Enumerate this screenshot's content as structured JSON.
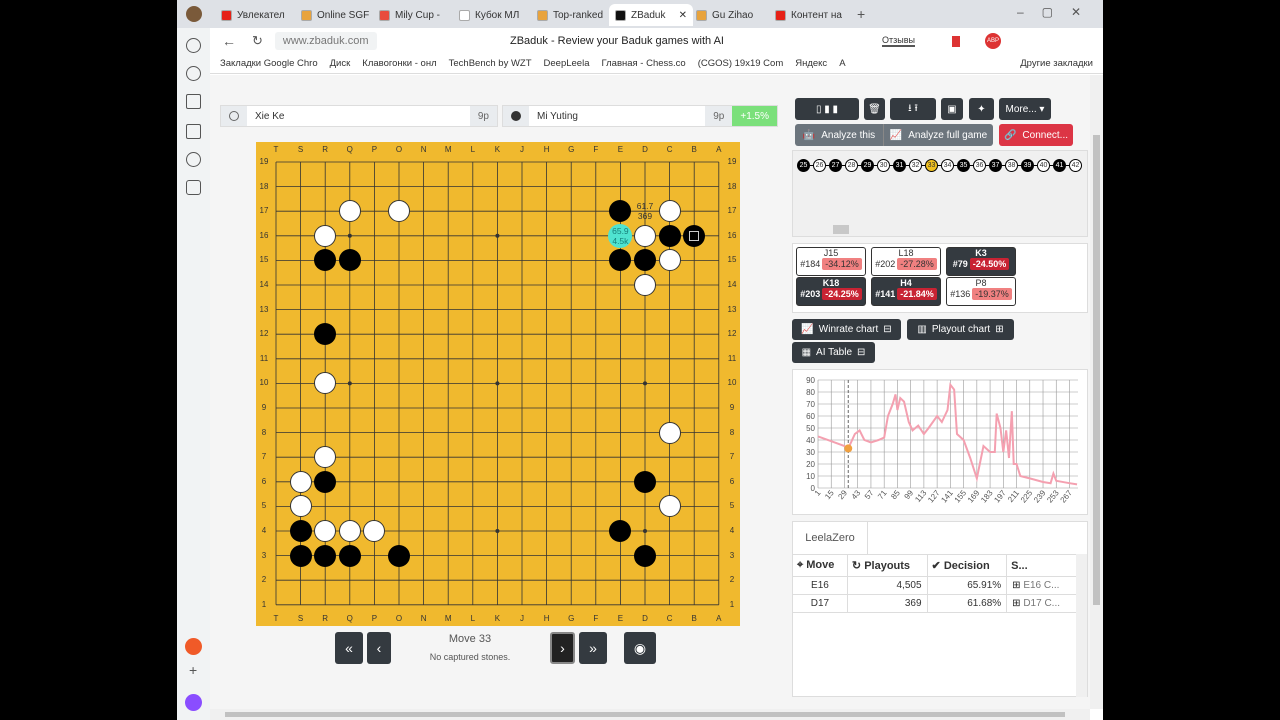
{
  "browser": {
    "tabs": [
      {
        "label": "Увлекател",
        "color": "#e62117"
      },
      {
        "label": "Online SGF",
        "color": "#e8a33d"
      },
      {
        "label": "Mily Cup -",
        "color": "#e84c3d"
      },
      {
        "label": "Кубок МЛ",
        "color": "#fff"
      },
      {
        "label": "Top-ranked",
        "color": "#e8a33d"
      },
      {
        "label": "ZBaduk",
        "color": "#111"
      },
      {
        "label": "Gu Zihao",
        "color": "#e8a33d"
      },
      {
        "label": "Контент на",
        "color": "#e62117"
      }
    ],
    "url": "www.zbaduk.com",
    "page_title": "ZBaduk - Review your Baduk games with AI",
    "reviews": "Отзывы",
    "bookmarks": [
      "Закладки Google Chro",
      "Диск",
      "Клавогонки - онл",
      "TechBench by WZT",
      "DeepLeela",
      "Главная - Chess.co",
      "(CGOS) 19x19 Com",
      "Яндекс",
      "A"
    ],
    "other_bookmarks": "Другие закладки"
  },
  "players": {
    "white": {
      "name": "Xie Ke",
      "rank": "9p"
    },
    "black": {
      "name": "Mi Yuting",
      "rank": "9p",
      "score": "+1.5%"
    }
  },
  "board": {
    "columns": [
      "T",
      "S",
      "R",
      "Q",
      "P",
      "O",
      "N",
      "M",
      "L",
      "K",
      "J",
      "H",
      "G",
      "F",
      "E",
      "D",
      "C",
      "B",
      "A"
    ],
    "rows": [
      "19",
      "18",
      "17",
      "16",
      "15",
      "14",
      "13",
      "12",
      "11",
      "10",
      "9",
      "8",
      "7",
      "6",
      "5",
      "4",
      "3",
      "2",
      "1"
    ],
    "black": [
      "E17",
      "C16",
      "B16",
      "E15",
      "D15",
      "R15",
      "Q15",
      "R12",
      "R6",
      "D6",
      "S4",
      "E4",
      "S3",
      "R3",
      "Q3",
      "O3",
      "D3"
    ],
    "white": [
      "Q17",
      "O17",
      "C17",
      "R16",
      "D16",
      "C15",
      "D14",
      "R10",
      "C8",
      "R7",
      "S6",
      "S5",
      "C5",
      "R4",
      "Q4",
      "P4"
    ],
    "last_move": "B16",
    "candidates": [
      {
        "point": "E16",
        "winrate": "65.9",
        "playouts": "4.5k",
        "best": true
      },
      {
        "point": "D17",
        "winrate": "61.7",
        "playouts": "369",
        "best": false
      }
    ]
  },
  "nav": {
    "move": "Move 33",
    "captured": "No captured stones.",
    "first": "«",
    "prev": "‹",
    "next": "›",
    "last": "»"
  },
  "toolbar": {
    "more": "More...",
    "analyze_this": "Analyze this",
    "analyze_full": "Analyze full game",
    "connect": "Connect...",
    "connect_color": "#dc3545"
  },
  "moves": {
    "numbers": [
      25,
      26,
      27,
      28,
      29,
      30,
      31,
      32,
      33,
      34,
      35,
      36,
      37,
      38,
      39,
      40,
      41,
      42
    ],
    "current": 33
  },
  "mistakes": [
    {
      "move": "J15",
      "num": "#184",
      "delta": "-34.12%",
      "style": "light"
    },
    {
      "move": "L18",
      "num": "#202",
      "delta": "-27.28%",
      "style": "light"
    },
    {
      "move": "K3",
      "num": "#79",
      "delta": "-24.50%",
      "style": "dark"
    },
    {
      "move": "K18",
      "num": "#203",
      "delta": "-24.25%",
      "style": "dark"
    },
    {
      "move": "H4",
      "num": "#141",
      "delta": "-21.84%",
      "style": "dark"
    },
    {
      "move": "P8",
      "num": "#136",
      "delta": "-19.37%",
      "style": "light"
    }
  ],
  "toggles": {
    "winrate": "Winrate chart",
    "playout": "Playout chart",
    "ai_table": "AI Table"
  },
  "chart_data": {
    "type": "line",
    "title": "",
    "xlabel": "",
    "ylabel": "",
    "ylim": [
      0,
      90
    ],
    "yticks": [
      0,
      10,
      20,
      30,
      40,
      50,
      60,
      70,
      80,
      90
    ],
    "xticks": [
      1,
      15,
      29,
      43,
      57,
      71,
      85,
      99,
      113,
      127,
      141,
      155,
      169,
      183,
      197,
      211,
      225,
      239,
      253,
      267
    ],
    "current_move": 33,
    "line_color": "#f4a0b0",
    "series": [
      {
        "name": "winrate",
        "x": [
          1,
          15,
          29,
          33,
          40,
          45,
          50,
          57,
          65,
          71,
          75,
          80,
          83,
          85,
          88,
          92,
          97,
          101,
          107,
          113,
          118,
          127,
          132,
          138,
          141,
          145,
          148,
          155,
          162,
          169,
          176,
          183,
          188,
          190,
          194,
          197,
          200,
          203,
          206,
          208,
          211,
          215,
          225,
          239,
          247,
          250,
          253,
          267,
          275
        ],
        "y": [
          43,
          39,
          35,
          33,
          45,
          48,
          40,
          38,
          40,
          42,
          60,
          70,
          78,
          65,
          75,
          72,
          55,
          48,
          52,
          45,
          50,
          60,
          55,
          65,
          86,
          82,
          45,
          40,
          25,
          8,
          35,
          30,
          30,
          62,
          50,
          30,
          48,
          25,
          64,
          20,
          20,
          10,
          8,
          5,
          4,
          12,
          6,
          4,
          3
        ]
      }
    ]
  },
  "ai_table": {
    "engine": "LeelaZero",
    "headers": [
      "Move",
      "Playouts",
      "Decision",
      "S..."
    ],
    "rows": [
      {
        "move": "E16",
        "playouts": "4,505",
        "decision": "65.91%",
        "seq": "E16 C..."
      },
      {
        "move": "D17",
        "playouts": "369",
        "decision": "61.68%",
        "seq": "D17 C..."
      }
    ]
  }
}
